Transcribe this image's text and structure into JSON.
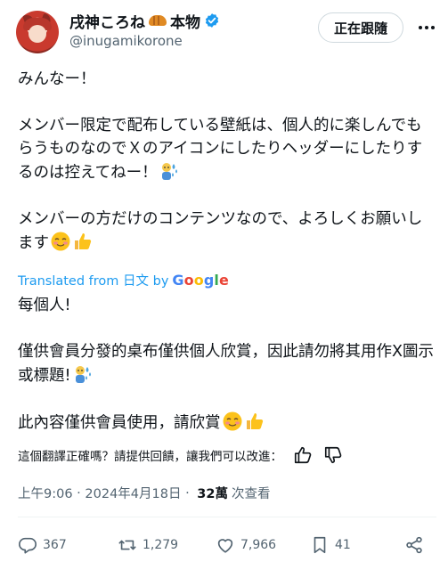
{
  "author": {
    "display_name": "戌神ころね",
    "name_suffix": "本物",
    "handle": "@inugamikorone"
  },
  "follow_button": {
    "label": "正在跟隨"
  },
  "tweet": {
    "line1": "みんなー！",
    "line2": "メンバー限定で配布している壁紙は、個人的に楽しんでもらうものなのでＸのアイコンにしたりヘッダーにしたりするのは控えてねー！",
    "line3": "メンバーの方だけのコンテンツなので、よろしくお願いします"
  },
  "translation_bar": {
    "prefix": "Translated from 日文 by",
    "brand": [
      "G",
      "o",
      "o",
      "g",
      "l",
      "e"
    ]
  },
  "translation": {
    "line1": "每個人!",
    "line2": "僅供會員分發的桌布僅供個人欣賞，因此請勿將其用作X圖示或標題!",
    "line3": "此內容僅供會員使用，請欣賞"
  },
  "feedback": {
    "prompt": "這個翻譯正確嗎？請提供回饋，讓我們可以改進："
  },
  "meta": {
    "time": "上午9:06",
    "separator": " · ",
    "date": "2024年4月18日",
    "separator2": " · ",
    "views": "32萬",
    "views_label": "次查看"
  },
  "actions": {
    "replies": "367",
    "reposts": "1,279",
    "likes": "7,966",
    "bookmarks": "41"
  },
  "colors": {
    "link": "#1d9bf0",
    "verified": "#1d9bf0",
    "muted": "#536471"
  },
  "icons": [
    "verified-badge-icon",
    "croissant-icon",
    "more-icon",
    "thumbs-up-icon",
    "thumbs-down-icon",
    "reply-icon",
    "repost-icon",
    "like-icon",
    "bookmark-icon",
    "share-icon",
    "sweat-person-emoji",
    "smiling-face-emoji",
    "thumbs-up-emoji"
  ]
}
